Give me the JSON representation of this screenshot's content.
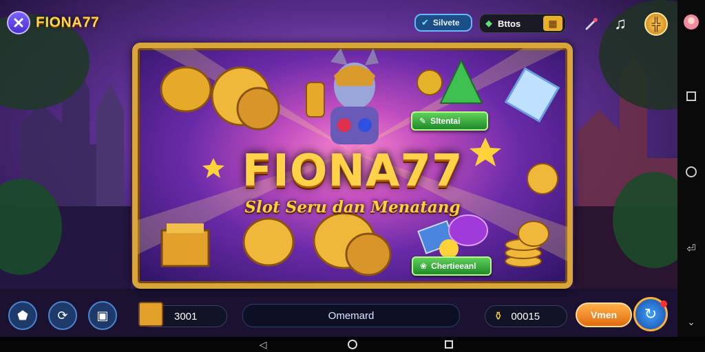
{
  "app": {
    "brand_name": "FIONA77",
    "close_icon": "close-icon"
  },
  "header": {
    "silver_label": "Silvete",
    "bonus_label": "Bttos",
    "grid_icon": "grid-icon",
    "music_icon": "music-note-icon",
    "wand_icon": "wand-icon",
    "profile_icon": "avatar"
  },
  "banner": {
    "title": "FIONA77",
    "subtitle": "Slot Seru dan Menatang",
    "button_top_label": "Sltentai",
    "button_bottom_label": "Chertieeanl"
  },
  "bottom": {
    "coins_value": "3001",
    "center_label": "Omemard",
    "balance_value": "00015",
    "action_label": "Vmen"
  },
  "colors": {
    "accent_gold": "#ffd24a",
    "button_green": "#2fa83a",
    "action_orange": "#f28a1a"
  }
}
